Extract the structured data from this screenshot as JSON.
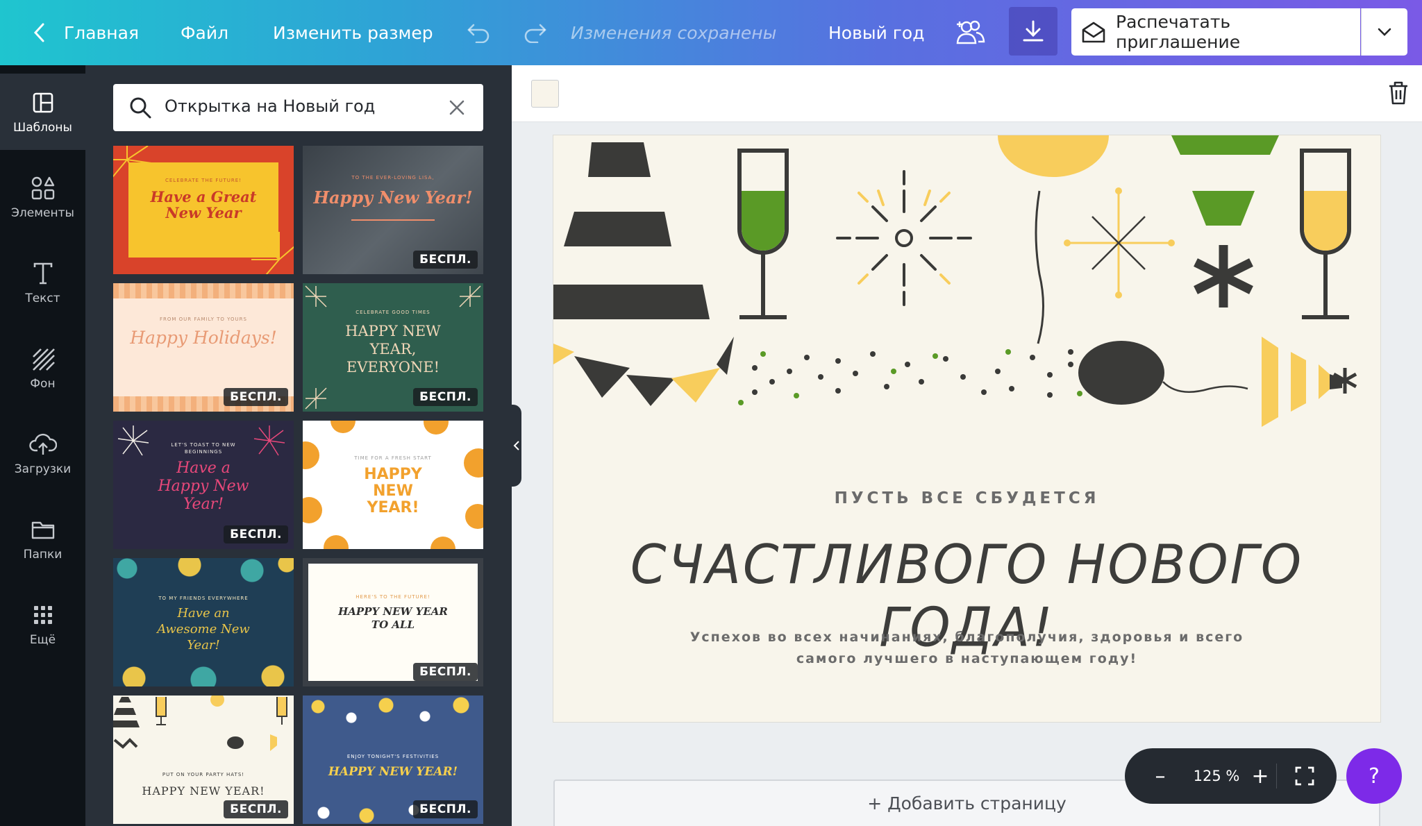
{
  "topbar": {
    "home": "Главная",
    "file": "Файл",
    "resize": "Изменить размер",
    "saved_status": "Изменения сохранены",
    "design_title": "Новый год",
    "print_button": "Распечатать приглашение"
  },
  "rail": {
    "items": [
      {
        "label": "Шаблоны",
        "icon": "templates-icon"
      },
      {
        "label": "Элементы",
        "icon": "elements-icon"
      },
      {
        "label": "Текст",
        "icon": "text-icon"
      },
      {
        "label": "Фон",
        "icon": "background-icon"
      },
      {
        "label": "Загрузки",
        "icon": "upload-icon"
      },
      {
        "label": "Папки",
        "icon": "folder-icon"
      },
      {
        "label": "Ещё",
        "icon": "more-icon"
      }
    ]
  },
  "search": {
    "value": "Открытка на Новый год"
  },
  "templates": {
    "free_badge": "БЕСПЛ.",
    "items": [
      {
        "top": "CELEBRATE THE FUTURE!",
        "title": "Have a Great New Year",
        "colors": [
          "#d9432a",
          "#f7c42d"
        ]
      },
      {
        "top": "TO THE EVER-LOVING LISA,",
        "title": "Happy New Year!",
        "colors": [
          "#4a5259",
          "#f08e6b"
        ]
      },
      {
        "top": "FROM OUR FAMILY TO YOURS",
        "title": "Happy Holidays!",
        "colors": [
          "#fde8d8",
          "#e89a74"
        ]
      },
      {
        "top": "CELEBRATE GOOD TIMES",
        "title": "HAPPY NEW YEAR, EVERYONE!",
        "colors": [
          "#2f5e4e",
          "#f1d7b8"
        ]
      },
      {
        "top": "LET'S TOAST TO NEW BEGINNINGS",
        "title": "Have a Happy New Year!",
        "colors": [
          "#2b2942",
          "#e8487a"
        ]
      },
      {
        "top": "TIME FOR A FRESH START",
        "title": "HAPPY NEW YEAR!",
        "colors": [
          "#ffffff",
          "#f2a12d"
        ]
      },
      {
        "top": "TO MY FRIENDS EVERYWHERE",
        "title": "Have an Awesome New Year!",
        "colors": [
          "#1f3e55",
          "#e9c54a"
        ]
      },
      {
        "top": "HERE'S TO THE FUTURE!",
        "title": "HAPPY NEW YEAR TO ALL",
        "colors": [
          "#fffdf6",
          "#2e2e2e"
        ]
      },
      {
        "top": "PUT ON YOUR PARTY HATS!",
        "title": "HAPPY NEW YEAR!",
        "colors": [
          "#f8f5eb",
          "#3d3d3b"
        ]
      },
      {
        "top": "ENJOY TONIGHT'S FESTIVITIES",
        "title": "HAPPY NEW YEAR!",
        "colors": [
          "#3f5a8c",
          "#f6d04d"
        ]
      }
    ]
  },
  "card": {
    "subtitle": "ПУСТЬ ВСЕ СБУДЕТСЯ",
    "title": "СЧАСТЛИВОГО НОВОГО ГОДА!",
    "body": "Успехов во всех начинаниях, благополучия, здоровья и всего самого лучшего в наступающем году!",
    "colors": {
      "background": "#f8f5eb",
      "yellow": "#f8cd5c",
      "green": "#5a9a26",
      "dark": "#3a3a38"
    }
  },
  "zoom": {
    "value": "125 %",
    "minus": "–",
    "plus": "+"
  },
  "add_page": "+ Добавить страницу",
  "help": "?"
}
